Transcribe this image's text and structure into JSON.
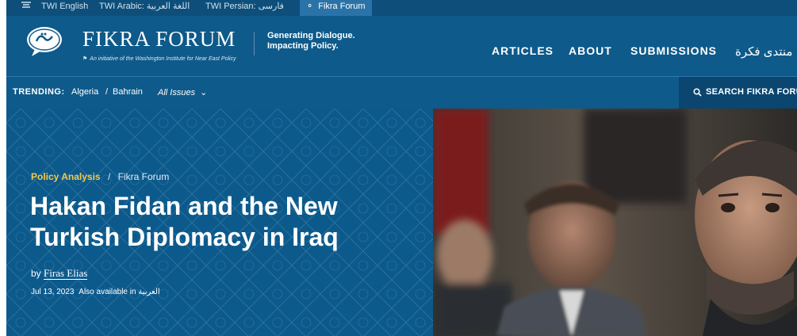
{
  "top_links": [
    "TWI English",
    "TWI Arabic: اللغة العربية",
    "TWI Persian: فارسی",
    "Fikra Forum"
  ],
  "brand": {
    "name": "FIKRA FORUM",
    "subtitle": "An initiative of the Washington Institute for Near East Policy",
    "tagline_line1": "Generating Dialogue.",
    "tagline_line2": "Impacting Policy."
  },
  "nav": {
    "articles": "ARTICLES",
    "about": "ABOUT",
    "submissions": "SUBMISSIONS",
    "arabic": "منتدى فكرة"
  },
  "trending": {
    "label": "TRENDING:",
    "items": [
      "Algeria",
      "/",
      "Bahrain"
    ],
    "all_issues": "All Issues"
  },
  "search": {
    "label": "SEARCH FIKRA FORUM"
  },
  "article": {
    "category": "Policy Analysis",
    "separator": "/",
    "section": "Fikra Forum",
    "title": "Hakan Fidan and the New Turkish Diplomacy in Iraq",
    "by": "by",
    "author": "Firas Elias",
    "date": "Jul 13, 2023",
    "also_available": "Also available in",
    "language": "العربية"
  },
  "colors": {
    "header_bg": "#0e5a8a",
    "accent_yellow": "#f2c94c"
  }
}
